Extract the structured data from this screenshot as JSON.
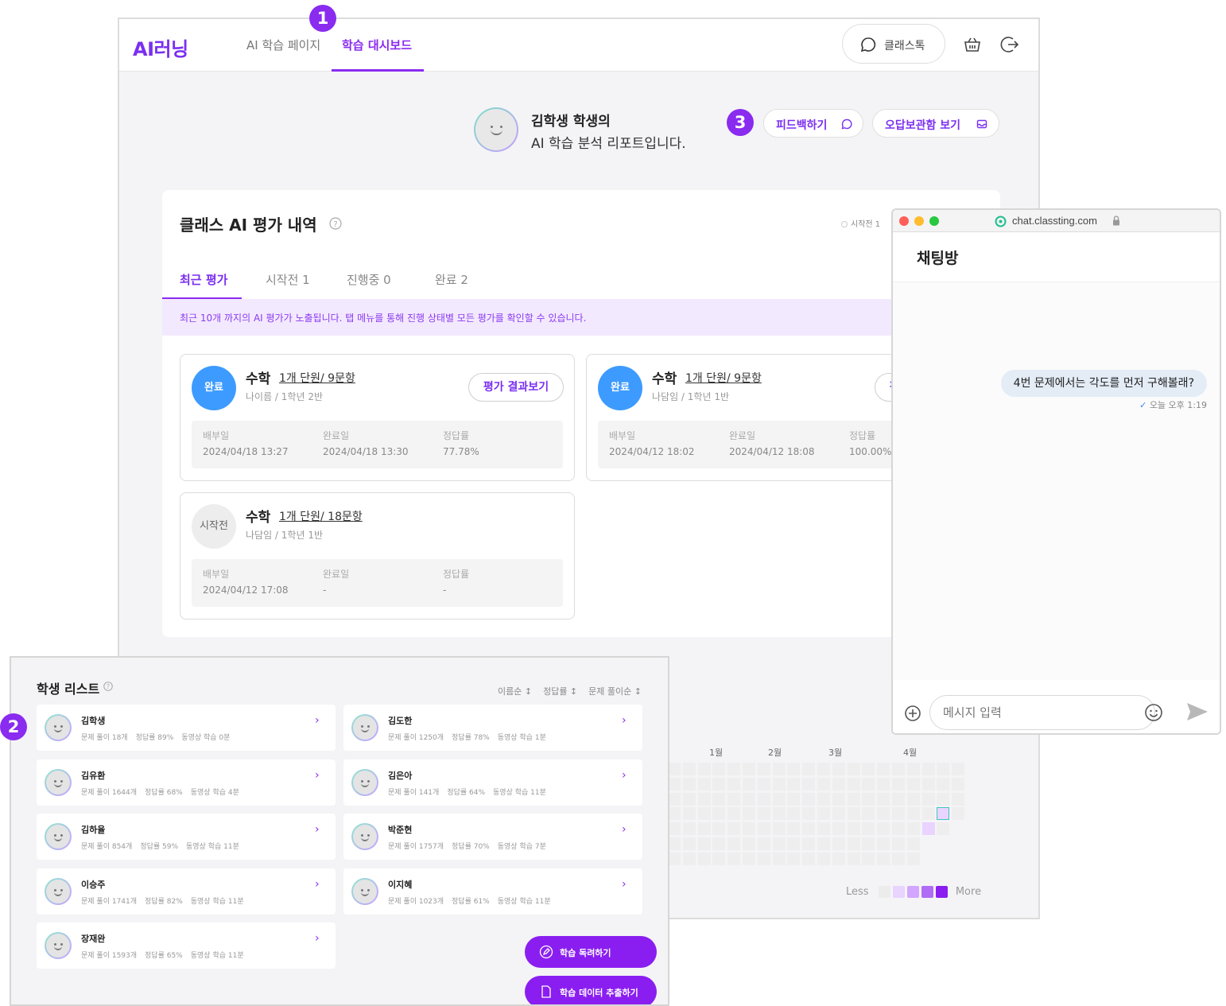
{
  "app": {
    "logo": "AI러닝"
  },
  "nav": {
    "tab1": "AI 학습 페이지",
    "tab2": "학습 대시보드",
    "classtalk": "클래스톡"
  },
  "profile": {
    "name_line": "김학생 학생의",
    "sub_line": "AI 학습 분석 리포트입니다.",
    "feedback_btn": "피드백하기",
    "wrongnote_btn": "오답보관함 보기"
  },
  "evaluation": {
    "title": "클래스 AI 평가 내역",
    "legend": "시작전 1",
    "tabs": [
      "최근 평가",
      "시작전 1",
      "진행중 0",
      "완료 2"
    ],
    "notice": "최근 10개 까지의 AI 평가가 노출됩니다. 탭 메뉴를 통해 진행 상태별 모든 평가를 확인할 수 있습니다.",
    "labels": {
      "assigned": "배부일",
      "completed": "완료일",
      "accuracy": "정답률"
    },
    "cards": [
      {
        "status": "완료",
        "subject": "수학",
        "unit": "1개 단원/ 9문항",
        "teacher": "나이름 / 1학년 2반",
        "result_btn": "평가 결과보기",
        "assigned": "2024/04/18 13:27",
        "completed": "2024/04/18 13:30",
        "accuracy": "77.78%"
      },
      {
        "status": "완료",
        "subject": "수학",
        "unit": "1개 단원/ 9문항",
        "teacher": "나담임 / 1학년 1반",
        "result_btn": "평가 결과보기",
        "assigned": "2024/04/12 18:02",
        "completed": "2024/04/12 18:08",
        "accuracy": "100.00%"
      },
      {
        "status": "시작전",
        "subject": "수학",
        "unit": "1개 단원/ 18문항",
        "teacher": "나담임 / 1학년 1반",
        "assigned": "2024/04/12 17:08",
        "completed": "-",
        "accuracy": "-"
      }
    ]
  },
  "heatmap": {
    "months": [
      "1월",
      "2월",
      "3월",
      "4월"
    ],
    "legend_less": "Less",
    "legend_more": "More",
    "colors": [
      "#ececec",
      "#e9d3ff",
      "#d2a6ff",
      "#b06cf5",
      "#8a1ef0"
    ]
  },
  "chat": {
    "url": "chat.classting.com",
    "title": "채팅방",
    "message": "4번 문제에서는 각도를 먼저 구해볼래?",
    "time": "오늘 오후 1:19",
    "input_placeholder": "메시지 입력"
  },
  "students": {
    "title": "학생 리스트",
    "sort": [
      "이름순 ↕",
      "정답률 ↕",
      "문제 풀이순 ↕"
    ],
    "list": [
      {
        "name": "김학생",
        "solved": "문제 풀이 18개",
        "accuracy": "정답률 89%",
        "video": "동영상 학습 0분"
      },
      {
        "name": "김도한",
        "solved": "문제 풀이 1250개",
        "accuracy": "정답률 78%",
        "video": "동영상 학습 1분"
      },
      {
        "name": "김유환",
        "solved": "문제 풀이 1644개",
        "accuracy": "정답률 68%",
        "video": "동영상 학습 4분"
      },
      {
        "name": "김은아",
        "solved": "문제 풀이 141개",
        "accuracy": "정답률 64%",
        "video": "동영상 학습 11분"
      },
      {
        "name": "김하율",
        "solved": "문제 풀이 854개",
        "accuracy": "정답률 59%",
        "video": "동영상 학습 11분"
      },
      {
        "name": "박준현",
        "solved": "문제 풀이 1757개",
        "accuracy": "정답률 70%",
        "video": "동영상 학습 7분"
      },
      {
        "name": "이승주",
        "solved": "문제 풀이 1741개",
        "accuracy": "정답률 82%",
        "video": "동영상 학습 11분"
      },
      {
        "name": "이지혜",
        "solved": "문제 풀이 1023개",
        "accuracy": "정답률 61%",
        "video": "동영상 학습 11분"
      },
      {
        "name": "장재완",
        "solved": "문제 풀이 1593개",
        "accuracy": "정답률 65%",
        "video": "동영상 학습 11분"
      }
    ],
    "encourage_btn": "학습 독려하기",
    "export_btn": "학습 데이터 추출하기"
  },
  "steps": [
    "1",
    "2",
    "3"
  ]
}
